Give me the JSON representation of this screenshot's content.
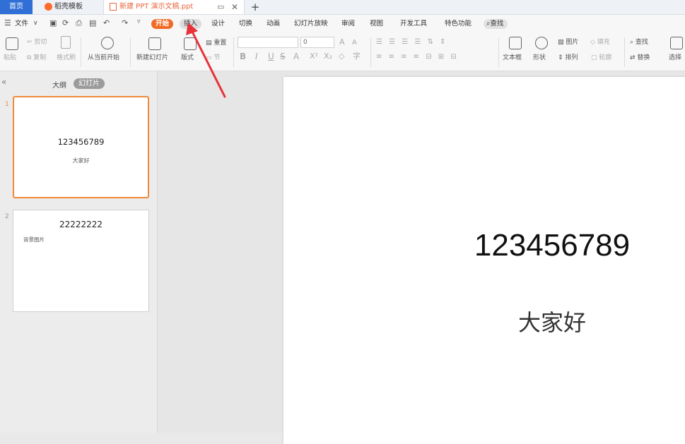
{
  "tabs": {
    "home": "首页",
    "template": "稻壳模板",
    "document": "新建 PPT 演示文稿.ppt"
  },
  "menu": {
    "file": "文件",
    "items": [
      "开始",
      "插入",
      "设计",
      "切换",
      "动画",
      "幻灯片放映",
      "审阅",
      "视图",
      "开发工具",
      "特色功能"
    ],
    "search": "查找"
  },
  "ribbon": {
    "paste": "粘贴",
    "cut": "剪切",
    "copy": "复制",
    "format_painter": "格式刷",
    "play_from_current": "从当前开始",
    "new_slide": "新建幻灯片",
    "layout": "版式",
    "reset": "重置",
    "section": "节",
    "font_size": "0",
    "text_box": "文本框",
    "shape": "形状",
    "arrange": "排列",
    "picture": "图片",
    "fill": "填充",
    "outline": "轮廓",
    "find": "查找",
    "replace": "替换",
    "select": "选择"
  },
  "leftpane": {
    "outline_tab": "大纲",
    "slides_tab": "幻灯片",
    "slides": [
      {
        "number": "1",
        "title": "123456789",
        "subtitle": "大家好"
      },
      {
        "number": "2",
        "title": "22222222",
        "subtitle": "背景图片"
      }
    ]
  },
  "slide": {
    "title": "123456789",
    "subtitle": "大家好"
  },
  "colors": {
    "accent": "#f16a24",
    "home_tab": "#2f6fd6",
    "arrow": "#e8323a"
  }
}
